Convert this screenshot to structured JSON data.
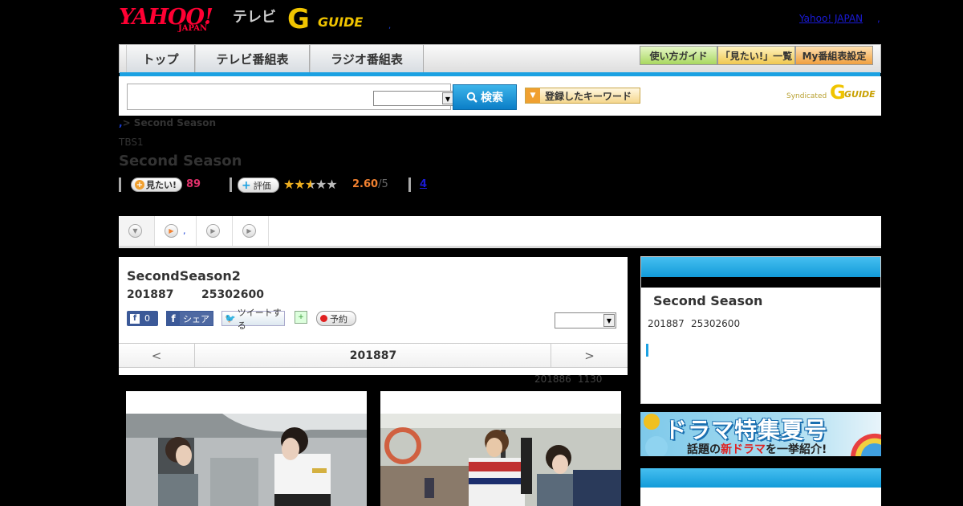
{
  "header": {
    "yahoo_logo_text": "YAHOO!",
    "yahoo_logo_sub": "JAPAN",
    "tv_label": "テレビ",
    "gguide_letter": "G",
    "gguide_text": "GUIDE",
    "dot": ",",
    "yahoo_japan_link": "Yahoo! JAPAN",
    "yahoo_japan_sep": ","
  },
  "nav": {
    "tabs": [
      "トップ",
      "テレビ番組表",
      "ラジオ番組表"
    ],
    "utility": [
      "使い方ガイド",
      "「見たい!」一覧",
      "My番組表設定"
    ]
  },
  "search": {
    "button_label": "検索",
    "keyword_button": "登録したキーワード",
    "syndicated_label": "Syndicated",
    "synd_letter": "G",
    "synd_guide": "GUIDE"
  },
  "program": {
    "breadcrumb_prefix": ",",
    "breadcrumb": "> Second Season",
    "station": "TBS1",
    "title": "Second Season",
    "mitai_label": "見たい!",
    "mitai_count": "89",
    "hyoka_label": "評価",
    "score": "2.60",
    "score_den": "/5",
    "review_count": "4"
  },
  "tabs_strip": {
    "tab2_text": ","
  },
  "episode": {
    "title": "SecondSeason2",
    "date": "201887",
    "time": "25302600",
    "fb_count": "0",
    "share_label": "シェア",
    "tweet_label": "ツイートする",
    "yoyaku_label": "予約",
    "pager_prev": "<",
    "pager_current": "201887",
    "pager_next": ">",
    "air_info_1": "201886",
    "air_info_2": "1130"
  },
  "side": {
    "title": "Second Season",
    "date": "201887",
    "time": "25302600",
    "banner_big": "ドラマ特集夏号",
    "banner_small_1": "話題の",
    "banner_small_red": "新ドラマ",
    "banner_small_2": "を一挙紹介!"
  },
  "colors": {
    "accent_blue": "#1ba1e2",
    "yahoo_red": "#ff0033",
    "gguide_yellow": "#f0c400",
    "mitai_pink": "#e0306a",
    "score_orange": "#f08030"
  },
  "icons": {
    "search": "search-icon",
    "facebook": "facebook-icon",
    "twitter": "twitter-bird-icon",
    "add": "add-program-icon",
    "record": "record-dot-icon",
    "tab_arrow": "play-arrow-icon"
  }
}
